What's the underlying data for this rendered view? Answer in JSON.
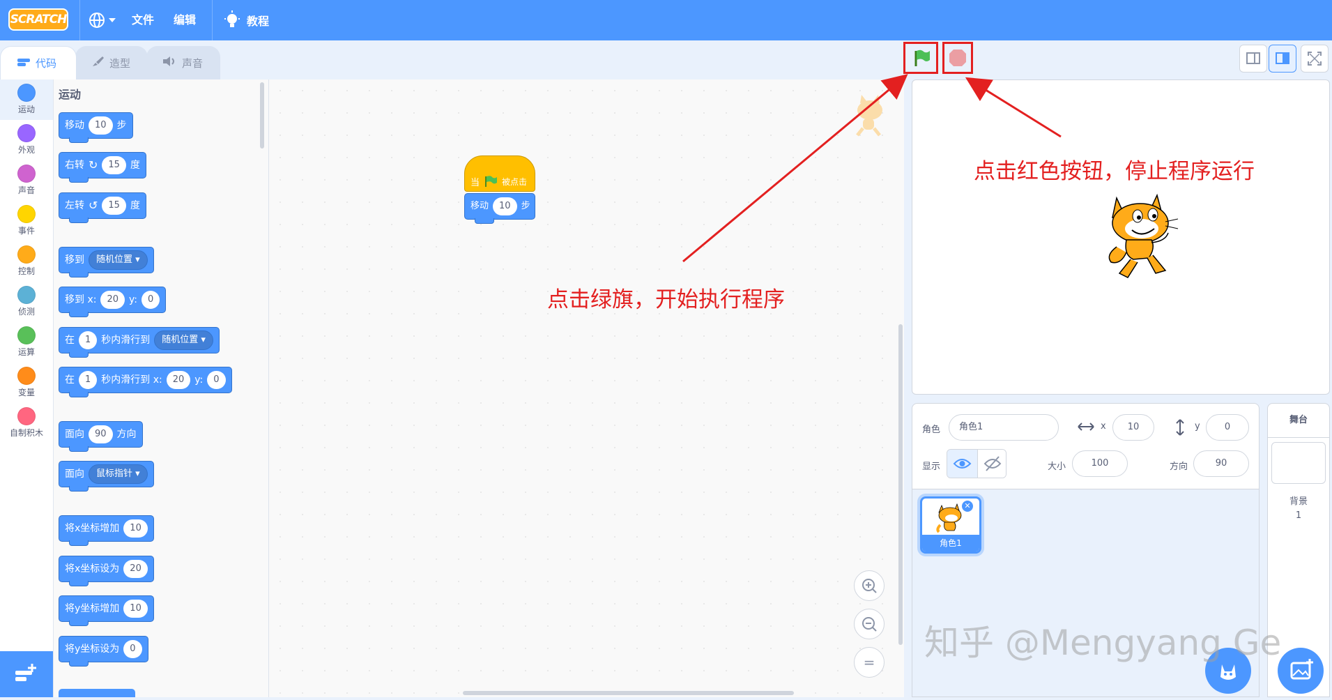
{
  "menubar": {
    "logo": "SCRATCH",
    "language_icon": "globe-icon",
    "file": "文件",
    "edit": "编辑",
    "tutorials": "教程"
  },
  "tabs": [
    {
      "label": "代码",
      "icon": "code-icon"
    },
    {
      "label": "造型",
      "icon": "brush-icon"
    },
    {
      "label": "声音",
      "icon": "speaker-icon"
    }
  ],
  "categories": [
    {
      "label": "运动",
      "color": "#4c97ff"
    },
    {
      "label": "外观",
      "color": "#9966ff"
    },
    {
      "label": "声音",
      "color": "#cf63cf"
    },
    {
      "label": "事件",
      "color": "#ffd500"
    },
    {
      "label": "控制",
      "color": "#ffab19"
    },
    {
      "label": "侦测",
      "color": "#5cb1d6"
    },
    {
      "label": "运算",
      "color": "#59c059"
    },
    {
      "label": "变量",
      "color": "#ff8c1a"
    },
    {
      "label": "自制积木",
      "color": "#ff6680"
    }
  ],
  "palette": {
    "title": "运动",
    "blocks": {
      "move": {
        "a": "移动",
        "v": "10",
        "b": "步"
      },
      "turn_right": {
        "a": "右转",
        "v": "15",
        "b": "度"
      },
      "turn_left": {
        "a": "左转",
        "v": "15",
        "b": "度"
      },
      "goto": {
        "a": "移到",
        "d": "随机位置"
      },
      "goto_xy": {
        "a": "移到 x:",
        "x": "20",
        "ya": "y:",
        "y": "0"
      },
      "glide": {
        "a": "在",
        "v": "1",
        "b": "秒内滑行到",
        "d": "随机位置"
      },
      "glide_xy": {
        "a": "在",
        "v": "1",
        "b": "秒内滑行到 x:",
        "x": "20",
        "ya": "y:",
        "y": "0"
      },
      "point_dir": {
        "a": "面向",
        "v": "90",
        "b": "方向"
      },
      "point_towards": {
        "a": "面向",
        "d": "鼠标指针"
      },
      "change_x": {
        "a": "将x坐标增加",
        "v": "10"
      },
      "set_x": {
        "a": "将x坐标设为",
        "v": "20"
      },
      "change_y": {
        "a": "将y坐标增加",
        "v": "10"
      },
      "set_y": {
        "a": "将y坐标设为",
        "v": "0"
      }
    }
  },
  "script": {
    "hat_a": "当",
    "hat_b": "被点击",
    "move_a": "移动",
    "move_v": "10",
    "move_b": "步"
  },
  "zoom": {
    "in": "+",
    "out": "−",
    "reset": "="
  },
  "sprite_info": {
    "sprite_label": "角色",
    "sprite_name": "角色1",
    "x_label": "x",
    "x": "10",
    "y_label": "y",
    "y": "0",
    "show_label": "显示",
    "size_label": "大小",
    "size": "100",
    "direction_label": "方向",
    "direction": "90"
  },
  "sprite_list": [
    {
      "name": "角色1"
    }
  ],
  "stage_panel": {
    "title": "舞台",
    "backdrops_label": "背景",
    "backdrops_count": "1"
  },
  "annotations": {
    "stop": "点击红色按钮，停止程序运行",
    "go": "点击绿旗，开始执行程序"
  },
  "watermark": "知乎 @Mengyang Ge",
  "colors": {
    "accent": "#4c97ff",
    "annotation": "#e32020",
    "motion": "#4c97ff",
    "event": "#ffbf00"
  }
}
